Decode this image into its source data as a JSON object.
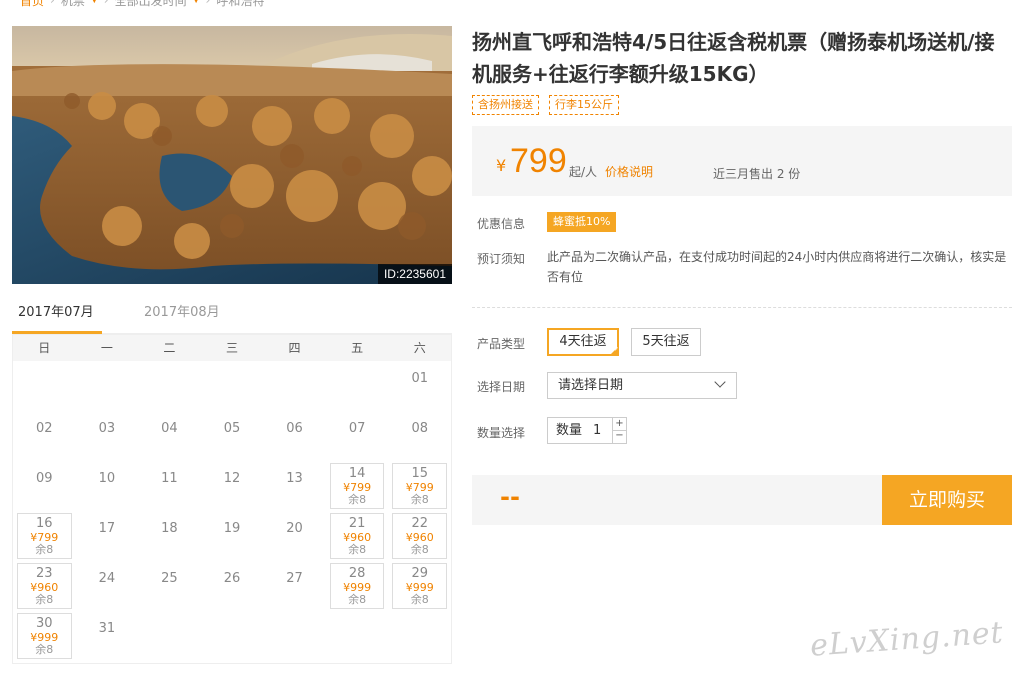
{
  "breadcrumb": {
    "home": "首页",
    "item1": "机票",
    "item2": "全部出发时间",
    "item3": "呼和浩特"
  },
  "hero": {
    "image_id": "ID:2235601"
  },
  "calendar": {
    "months": [
      "2017年07月",
      "2017年08月"
    ],
    "weekdays": [
      "日",
      "一",
      "二",
      "三",
      "四",
      "五",
      "六"
    ],
    "cells": [
      {
        "day": ""
      },
      {
        "day": ""
      },
      {
        "day": ""
      },
      {
        "day": ""
      },
      {
        "day": ""
      },
      {
        "day": ""
      },
      {
        "day": "01"
      },
      {
        "day": "02"
      },
      {
        "day": "03"
      },
      {
        "day": "04"
      },
      {
        "day": "05"
      },
      {
        "day": "06"
      },
      {
        "day": "07"
      },
      {
        "day": "08"
      },
      {
        "day": "09"
      },
      {
        "day": "10"
      },
      {
        "day": "11"
      },
      {
        "day": "12"
      },
      {
        "day": "13"
      },
      {
        "day": "14",
        "price": "¥799",
        "stock": "余8"
      },
      {
        "day": "15",
        "price": "¥799",
        "stock": "余8"
      },
      {
        "day": "16",
        "price": "¥799",
        "stock": "余8"
      },
      {
        "day": "17"
      },
      {
        "day": "18"
      },
      {
        "day": "19"
      },
      {
        "day": "20"
      },
      {
        "day": "21",
        "price": "¥960",
        "stock": "余8"
      },
      {
        "day": "22",
        "price": "¥960",
        "stock": "余8"
      },
      {
        "day": "23",
        "price": "¥960",
        "stock": "余8"
      },
      {
        "day": "24"
      },
      {
        "day": "25"
      },
      {
        "day": "26"
      },
      {
        "day": "27"
      },
      {
        "day": "28",
        "price": "¥999",
        "stock": "余8"
      },
      {
        "day": "29",
        "price": "¥999",
        "stock": "余8"
      },
      {
        "day": "30",
        "price": "¥999",
        "stock": "余8"
      },
      {
        "day": "31"
      },
      {
        "day": ""
      },
      {
        "day": ""
      },
      {
        "day": ""
      },
      {
        "day": ""
      },
      {
        "day": ""
      }
    ]
  },
  "product": {
    "title": "扬州直飞呼和浩特4/5日往返含税机票（赠扬泰机场送机/接机服务+往返行李额升级15KG）",
    "tags": [
      "含扬州接送",
      "行李15公斤"
    ],
    "price": {
      "currency": "¥",
      "amount": "799",
      "per": "起/人",
      "explain": "价格说明",
      "sold": "近三月售出 2 份"
    },
    "promo_label": "优惠信息",
    "promo_badge": "蜂蜜抵10%",
    "notice_label": "预订须知",
    "notice_text": "此产品为二次确认产品，在支付成功时间起的24小时内供应商将进行二次确认，核实是否有位",
    "type_label": "产品类型",
    "types": [
      "4天往返",
      "5天往返"
    ],
    "date_label": "选择日期",
    "date_placeholder": "请选择日期",
    "qty_label": "数量选择",
    "qty_field_label": "数量",
    "qty_value": "1",
    "qty_up": "+",
    "qty_down": "−",
    "total": "--",
    "buy_label": "立即购买"
  },
  "watermark": "eLvXing.net",
  "colors": {
    "accent": "#f5a623",
    "price": "#f08300"
  }
}
